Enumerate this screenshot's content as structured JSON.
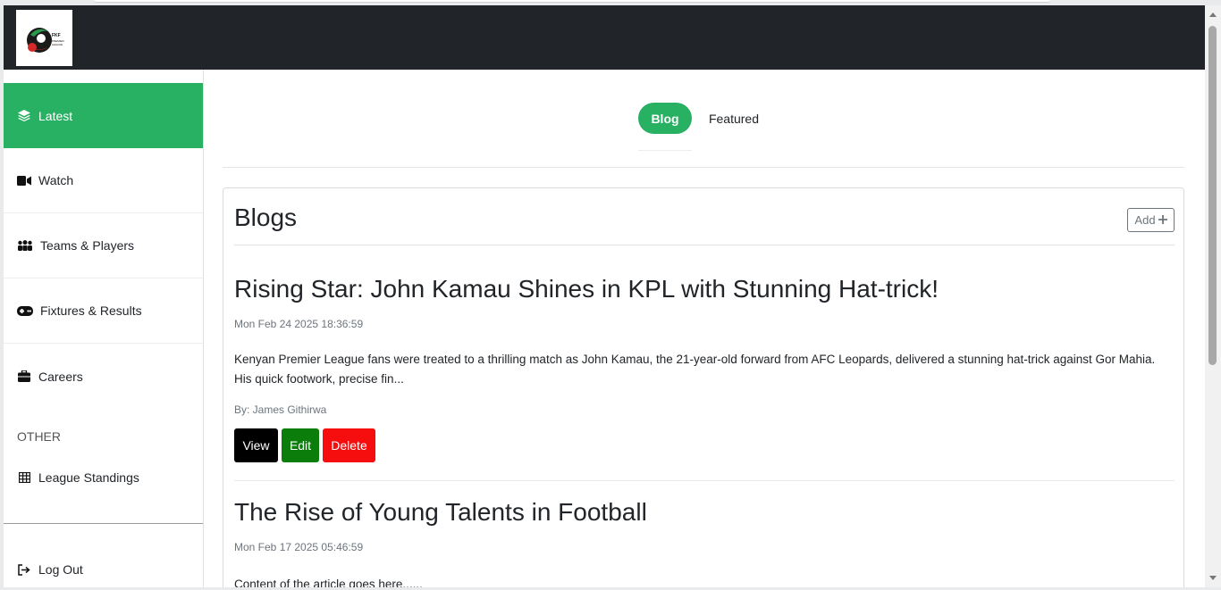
{
  "app": {
    "logo_text": "FKF PREMIER LEAGUE"
  },
  "sidebar": {
    "items": [
      {
        "label": "Latest",
        "icon": "layers-icon"
      },
      {
        "label": "Watch",
        "icon": "video-icon"
      },
      {
        "label": "Teams & Players",
        "icon": "people-icon"
      },
      {
        "label": "Fixtures & Results",
        "icon": "gamepad-icon"
      },
      {
        "label": "Careers",
        "icon": "briefcase-icon"
      }
    ],
    "other_heading": "OTHER",
    "other_items": [
      {
        "label": "League Standings",
        "icon": "table-icon"
      }
    ],
    "logout_label": "Log Out"
  },
  "tabs": {
    "active": "Blog",
    "other": "Featured"
  },
  "blogs": {
    "title": "Blogs",
    "add_label": "Add",
    "posts": [
      {
        "title": "Rising Star: John Kamau Shines in KPL with Stunning Hat-trick!",
        "date": "Mon Feb 24 2025 18:36:59",
        "excerpt": "Kenyan Premier League fans were treated to a thrilling match as John Kamau, the 21-year-old forward from AFC Leopards, delivered a stunning hat-trick against Gor Mahia. His quick footwork, precise fin...",
        "author": "By: James Githirwa",
        "view_label": "View",
        "edit_label": "Edit",
        "delete_label": "Delete"
      },
      {
        "title": "The Rise of Young Talents in Football",
        "date": "Mon Feb 17 2025 05:46:59",
        "excerpt": "Content of the article goes here......"
      }
    ]
  },
  "colors": {
    "accent": "#28b063",
    "topbar": "#212529",
    "view": "#000000",
    "edit": "#0a7d0a",
    "delete": "#f60d0d"
  }
}
